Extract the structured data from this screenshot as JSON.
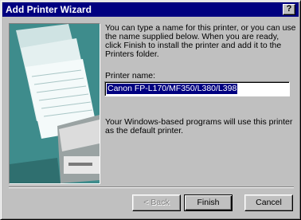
{
  "window": {
    "title": "Add Printer Wizard",
    "help_label": "?"
  },
  "content": {
    "intro_text": "You can type a name for this printer, or you can use the name supplied below. When you are ready, click Finish to install the printer and add it to the Printers folder.",
    "printer_name_label": "Printer name:",
    "printer_name_value": "Canon FP-L170/MF350/L380/L398",
    "description": "Your Windows-based programs will use this printer as the default printer."
  },
  "buttons": {
    "back": "< Back",
    "finish": "Finish",
    "cancel": "Cancel"
  },
  "colors": {
    "titlebar": "#000080",
    "face": "#c0c0c0",
    "art_background": "#3f8f8f"
  }
}
